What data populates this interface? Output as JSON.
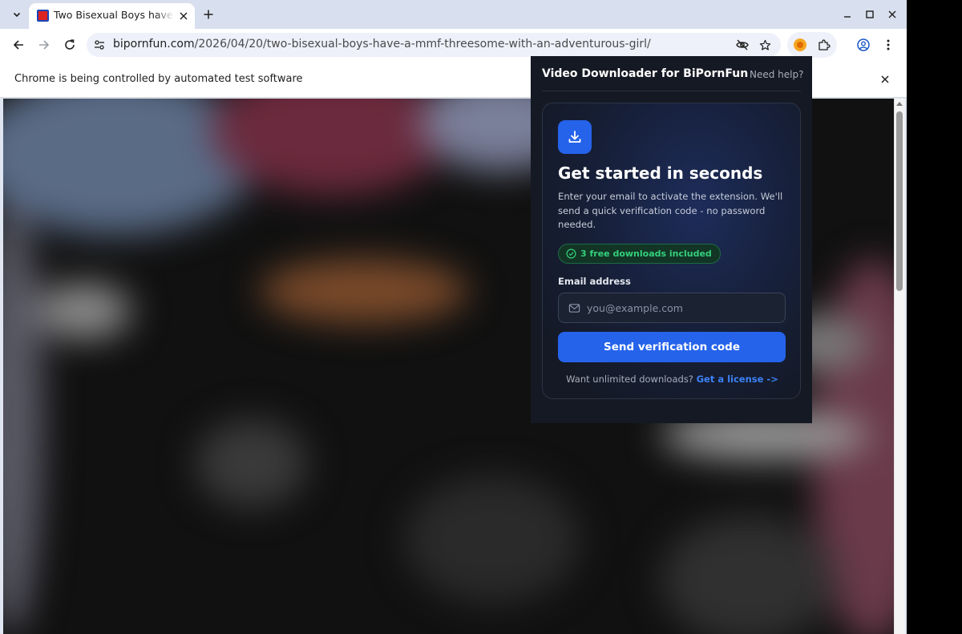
{
  "browser": {
    "tab": {
      "title": "Two Bisexual Boys have a MMF Threesome with an Adventurous Girl"
    },
    "address_bar": {
      "host": "bipornfun.com",
      "path": "/2026/04/20/two-bisexual-boys-have-a-mmf-threesome-with-an-adventurous-girl/"
    },
    "infobar": {
      "message": "Chrome is being controlled by automated test software"
    },
    "icons": {
      "tab_search": "chevron-down-icon",
      "tab_close": "close-icon",
      "new_tab": "plus-icon",
      "minimize": "minimize-icon",
      "maximize": "maximize-icon",
      "close_window": "close-icon",
      "back": "arrow-left-icon",
      "forward": "arrow-right-icon",
      "reload": "reload-icon",
      "site_info": "tune-icon",
      "tracking_protection": "eye-off-icon",
      "bookmark": "star-icon",
      "extension_active": "extension-badge-icon",
      "extensions": "puzzle-icon",
      "profile": "profile-icon",
      "menu": "kebab-menu-icon"
    }
  },
  "popup": {
    "title": "Video Downloader for BiPornFun",
    "help_link": "Need help?",
    "card": {
      "icon": "download-icon",
      "heading": "Get started in seconds",
      "description": "Enter your email to activate the extension. We'll send a quick verification code - no password needed.",
      "badge": "3 free downloads included",
      "email_label": "Email address",
      "email_placeholder": "you@example.com",
      "email_value": "",
      "submit_label": "Send verification code",
      "footer_text": "Want unlimited downloads?",
      "footer_link": "Get a license ->"
    },
    "colors": {
      "accent": "#2563eb",
      "badge_green": "#34d07a",
      "link_blue": "#3b82f6",
      "background": "#151923"
    }
  }
}
